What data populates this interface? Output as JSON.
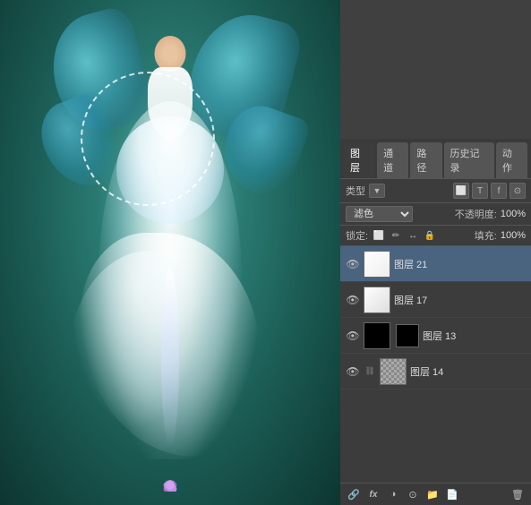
{
  "canvas": {
    "background_color": "#2a7a72"
  },
  "panel": {
    "tabs": [
      {
        "label": "图层",
        "active": true
      },
      {
        "label": "通道",
        "active": false
      },
      {
        "label": "路径",
        "active": false
      },
      {
        "label": "历史记录",
        "active": false
      },
      {
        "label": "动作",
        "active": false
      }
    ],
    "filter": {
      "label": "类型",
      "icons": [
        "☰",
        "T",
        "f",
        "⬛"
      ]
    },
    "blend_mode": "滤色",
    "opacity_label": "不透明度:",
    "opacity_value": "100%",
    "lock_label": "锁定:",
    "lock_icons": [
      "☰",
      "✏",
      "↔",
      "🔒"
    ],
    "fill_label": "填充:",
    "fill_value": "100%",
    "layers": [
      {
        "id": "layer-21",
        "name": "图层 21",
        "visible": true,
        "active": true,
        "thumb": "white",
        "has_mask": false
      },
      {
        "id": "layer-17",
        "name": "图层 17",
        "visible": true,
        "active": false,
        "thumb": "white",
        "has_mask": false
      },
      {
        "id": "layer-13",
        "name": "图层 13",
        "visible": true,
        "active": false,
        "thumb": "mask",
        "has_mask": true
      },
      {
        "id": "layer-14",
        "name": "图层 14",
        "visible": true,
        "active": false,
        "thumb": "checkered",
        "has_mask": false,
        "has_chain": true
      }
    ],
    "bottom_icons": [
      "🔗",
      "fx",
      "◐",
      "📄",
      "📁",
      "🗑"
    ]
  }
}
